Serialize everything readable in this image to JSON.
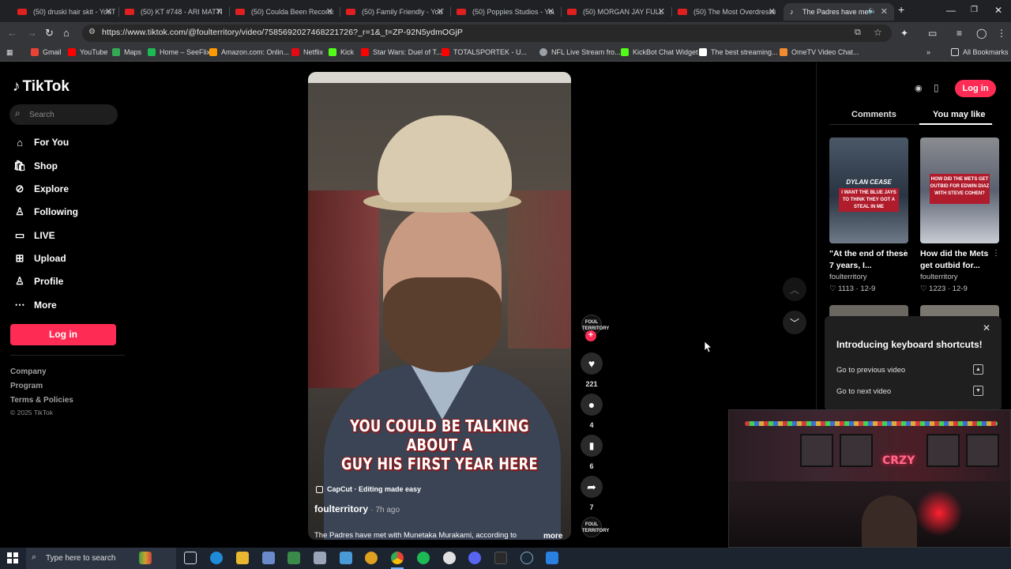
{
  "browser": {
    "tabs": [
      {
        "title": "(50) druski hair skit - YouTu",
        "active": false
      },
      {
        "title": "(50) KT #748 - ARI MATTI",
        "active": false
      },
      {
        "title": "(50) Coulda Been Records",
        "active": false
      },
      {
        "title": "(50) Family Friendly - YouT",
        "active": false
      },
      {
        "title": "(50) Poppies Studios - You",
        "active": false
      },
      {
        "title": "(50) MORGAN JAY FULL S",
        "active": false
      },
      {
        "title": "(50) The Most Overdresse",
        "active": false
      },
      {
        "title": "The Padres have met w",
        "active": true
      }
    ],
    "url": "https://www.tiktok.com/@foulterritory/video/7585692027468221726?_r=1&_t=ZP-92N5ydmOGjP",
    "bookmarks": [
      {
        "label": "Gmail",
        "color": "#ea4335"
      },
      {
        "label": "YouTube",
        "color": "#ff0000"
      },
      {
        "label": "Maps",
        "color": "#34a853"
      },
      {
        "label": "Home – SeeFlix",
        "color": "#1db954"
      },
      {
        "label": "Amazon.com: Onlin...",
        "color": "#ff9900"
      },
      {
        "label": "Netflix",
        "color": "#e50914"
      },
      {
        "label": "Kick",
        "color": "#53fc18"
      },
      {
        "label": "Star Wars: Duel of T...",
        "color": "#ff0000"
      },
      {
        "label": "TOTALSPORTEK - U...",
        "color": "#d42a2a"
      },
      {
        "label": "NFL Live Stream fro...",
        "color": "#9aa0a6"
      },
      {
        "label": "KickBot Chat Widget",
        "color": "#53fc18"
      },
      {
        "label": "The best streaming...",
        "color": "#ffffff"
      },
      {
        "label": "OmeTV Video Chat...",
        "color": "#f28b30"
      }
    ],
    "all_bookmarks": "All Bookmarks"
  },
  "tiktok": {
    "logo": "TikTok",
    "search_placeholder": "Search",
    "nav": [
      {
        "label": "For You",
        "icon": "home-icon"
      },
      {
        "label": "Shop",
        "icon": "shop-icon"
      },
      {
        "label": "Explore",
        "icon": "compass-icon"
      },
      {
        "label": "Following",
        "icon": "following-icon"
      },
      {
        "label": "LIVE",
        "icon": "live-icon"
      },
      {
        "label": "Upload",
        "icon": "upload-icon"
      },
      {
        "label": "Profile",
        "icon": "profile-icon"
      },
      {
        "label": "More",
        "icon": "more-icon"
      }
    ],
    "login_label": "Log in",
    "footer": [
      "Company",
      "Program",
      "Terms & Policies"
    ],
    "copyright": "© 2025 TikTok",
    "accent": "#fe2c55",
    "video": {
      "subtitle_line1": "YOU COULD BE TALKING ABOUT A",
      "subtitle_line2": "GUY HIS FIRST YEAR HERE",
      "capcut": "CapCut · Editing made easy",
      "author": "foulterritory",
      "ago": "· 7h ago",
      "description": "The Padres have met with Munetaka Murakami, according to",
      "more": "more",
      "progress": 0.49
    },
    "actions": {
      "avatar_text": "FOUL TERRITORY",
      "likes": "221",
      "comments": "4",
      "saves": "6",
      "shares": "7"
    },
    "right_panel": {
      "login_label": "Log in",
      "tab_comments": "Comments",
      "tab_you_may_like": "You may like",
      "videos": [
        {
          "thumb_caption_top": "DYLAN CEASE",
          "thumb_caption": "I WANT THE BLUE JAYS TO THINK THEY GOT A STEAL IN ME",
          "title": "\"At the end of these 7 years, I...",
          "author": "foulterritory",
          "stats": "♡ 1113  ·  12-9"
        },
        {
          "thumb_caption_top": "",
          "thumb_caption": "HOW DID THE METS GET OUTBID FOR EDWIN DIAZ WITH STEVE COHEN?",
          "title": "How did the Mets get outbid for...",
          "author": "foulterritory",
          "stats": "♡ 1223  ·  12-9"
        }
      ]
    },
    "shortcuts": {
      "title": "Introducing keyboard shortcuts!",
      "rows": [
        {
          "label": "Go to previous video",
          "key": "▲"
        },
        {
          "label": "Go to next video",
          "key": "▼"
        }
      ]
    },
    "webcam_neon": "CRZY"
  },
  "taskbar": {
    "search_placeholder": "Type here to search"
  }
}
